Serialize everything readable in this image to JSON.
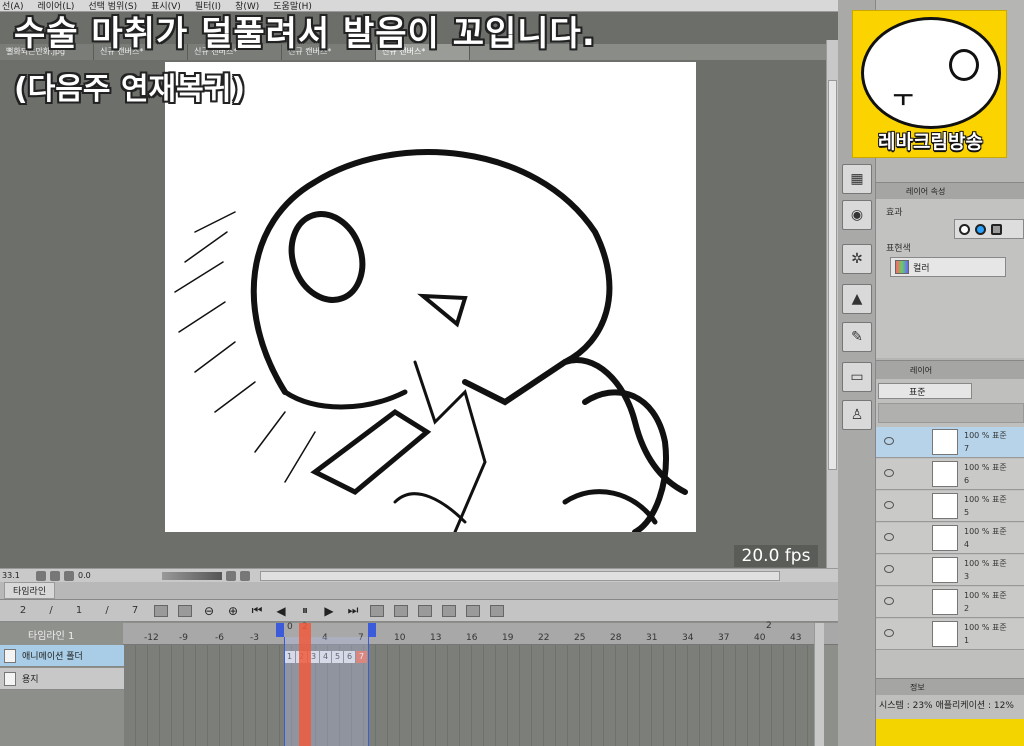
{
  "menu": {
    "items": [
      "선(A)",
      "레이어(L)",
      "선택 범위(S)",
      "표시(V)",
      "필터(I)",
      "창(W)",
      "도움말(H)"
    ]
  },
  "tabs": [
    {
      "label": "뻘화되는만화.jpg"
    },
    {
      "label": "신규 캔버스*"
    },
    {
      "label": "신규 캔버스*"
    },
    {
      "label": "신규 캔버스*"
    },
    {
      "label": "신규 캔버스*"
    }
  ],
  "overlay": {
    "line1": "수술 마취가 덜풀려서 발음이 꼬입니다.",
    "line2": "(다음주 연재복귀)"
  },
  "canvas": {
    "fps": "20.0 fps"
  },
  "status": {
    "zoom": "33.1",
    "value": "0.0"
  },
  "timeline": {
    "tab_label": "타임라인",
    "toolbar": {
      "frame_a": "2",
      "frame_b": "1",
      "frame_c": "7"
    },
    "track_name": "타임라인 1",
    "ruler": [
      "-12",
      "-9",
      "-6",
      "-3",
      "0",
      "2",
      "4",
      "7",
      "10",
      "13",
      "16",
      "19",
      "22",
      "25",
      "28",
      "31",
      "34",
      "37",
      "40",
      "43"
    ],
    "ruler_top": "2",
    "rows": [
      {
        "label": "애니메이션 폴더"
      },
      {
        "label": "용지"
      }
    ],
    "frames": [
      "1",
      "2",
      "3",
      "4",
      "5",
      "6",
      "7"
    ]
  },
  "logo": {
    "mouth": "ㅜ",
    "brand": "레바크림방송"
  },
  "props": {
    "tab": "레이어 속성",
    "effect_label": "효과",
    "color_label": "표현색",
    "color_value": "컬러"
  },
  "layers": {
    "tab": "레이어",
    "blend": "표준",
    "items": [
      {
        "pct": "100 % 표준",
        "num": "7"
      },
      {
        "pct": "100 % 표준",
        "num": "6"
      },
      {
        "pct": "100 % 표준",
        "num": "5"
      },
      {
        "pct": "100 % 표준",
        "num": "4"
      },
      {
        "pct": "100 % 표준",
        "num": "3"
      },
      {
        "pct": "100 % 표준",
        "num": "2"
      },
      {
        "pct": "100 % 표준",
        "num": "1"
      }
    ]
  },
  "info": {
    "tab": "정보",
    "text": "시스템 : 23%  애플리케이션 : 12%"
  }
}
